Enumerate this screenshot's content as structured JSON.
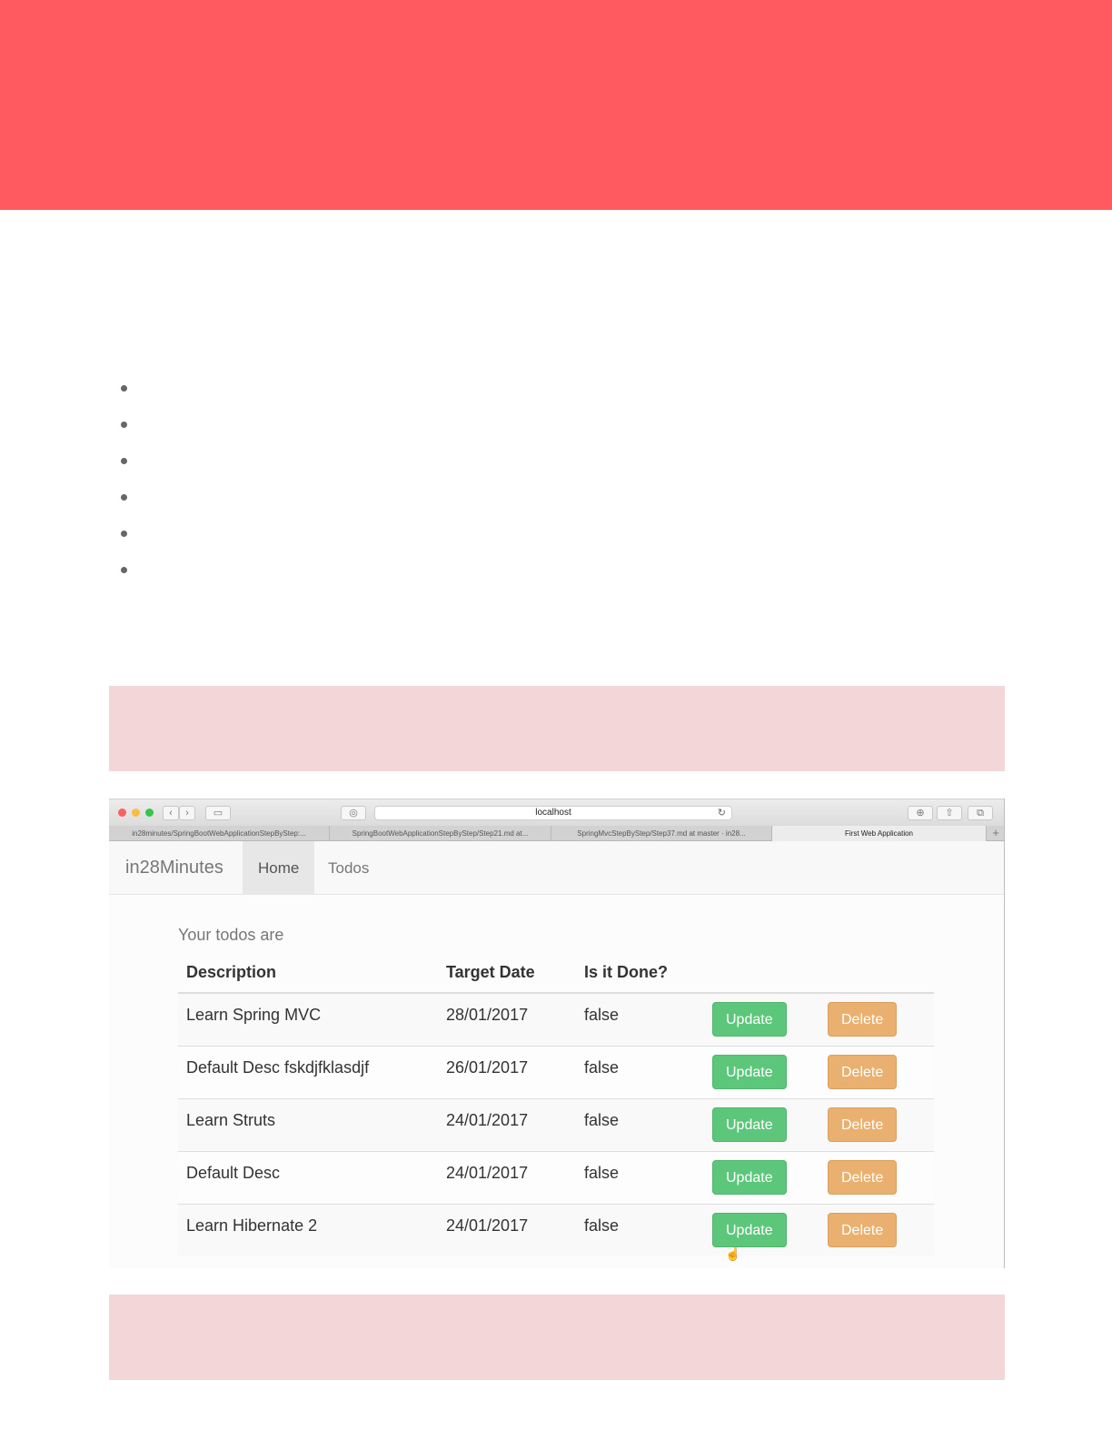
{
  "colors": {
    "banner": "#ff5a5f",
    "callout": "#f3d6d7",
    "update_button": "#5cc77a",
    "delete_button": "#eab06f"
  },
  "bullet_count": 6,
  "browser": {
    "address": "localhost",
    "tabs": [
      "in28minutes/SpringBootWebApplicationStepByStep:...",
      "SpringBootWebApplicationStepByStep/Step21.md at...",
      "SpringMvcStepByStep/Step37.md at master · in28...",
      "First Web Application"
    ],
    "icons": {
      "back": "chevron-left-icon",
      "forward": "chevron-right-icon",
      "sidebar": "sidebar-icon",
      "privacy": "privacy-icon",
      "reload": "reload-icon",
      "download": "download-icon",
      "share": "share-icon",
      "tabs": "tabs-overview-icon"
    }
  },
  "app": {
    "brand": "in28Minutes",
    "nav": [
      "Home",
      "Todos"
    ],
    "active_nav": "Home",
    "heading": "Your todos are",
    "columns": [
      "Description",
      "Target Date",
      "Is it Done?"
    ],
    "update_label": "Update",
    "delete_label": "Delete",
    "todos": [
      {
        "description": "Learn Spring MVC",
        "target_date": "28/01/2017",
        "done": "false"
      },
      {
        "description": "Default Desc fskdjfklasdjf",
        "target_date": "26/01/2017",
        "done": "false"
      },
      {
        "description": "Learn Struts",
        "target_date": "24/01/2017",
        "done": "false"
      },
      {
        "description": "Default Desc",
        "target_date": "24/01/2017",
        "done": "false"
      },
      {
        "description": "Learn Hibernate 2",
        "target_date": "24/01/2017",
        "done": "false"
      }
    ]
  }
}
